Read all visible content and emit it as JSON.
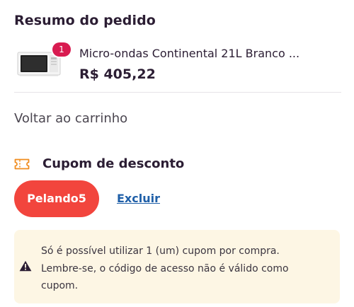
{
  "summary": {
    "title": "Resumo do pedido"
  },
  "item": {
    "image_alt": "microwave-image",
    "quantity": "1",
    "name": "Micro-ondas Continental 21L Branco ...",
    "price": "R$ 405,22"
  },
  "navigation": {
    "back_label": "Voltar ao carrinho"
  },
  "coupon": {
    "title": "Cupom de desconto",
    "icon": "ticket-icon",
    "code": "Pelando5",
    "remove_label": "Excluir"
  },
  "notice": {
    "icon": "warning-icon",
    "lines": [
      "Só é possível utilizar 1 (um) cupom por compra.",
      "Lembre-se, o código de acesso não é válido como",
      "cupom."
    ]
  },
  "colors": {
    "text": "#2b1d33",
    "badge": "#d81b50",
    "coupon_chip": "#f2453d",
    "link": "#1f5fa8",
    "ticket_icon": "#f08c1f",
    "notice_bg": "#fdf6e4"
  }
}
